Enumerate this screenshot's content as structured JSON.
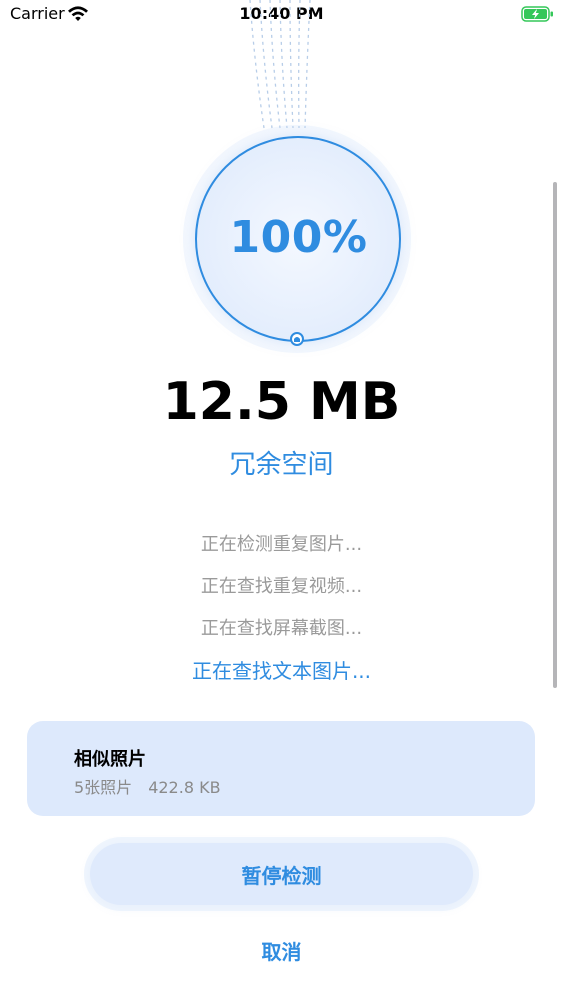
{
  "status_bar": {
    "carrier": "Carrier",
    "time": "10:40 PM"
  },
  "progress": {
    "percent_label": "100%",
    "value": 1.0,
    "color": "#2f8ce0"
  },
  "summary": {
    "size": "12.5 MB",
    "label": "冗余空间"
  },
  "scan_steps": [
    {
      "label": "正在检测重复图片...",
      "active": false
    },
    {
      "label": "正在查找重复视频...",
      "active": false
    },
    {
      "label": "正在查找屏幕截图...",
      "active": false
    },
    {
      "label": "正在查找文本图片...",
      "active": true
    }
  ],
  "result_card": {
    "title": "相似照片",
    "count": "5张照片",
    "size": "422.8 KB"
  },
  "actions": {
    "pause_label": "暂停检测",
    "cancel_label": "取消"
  },
  "colors": {
    "accent": "#2f8ce0",
    "card_bg": "#dde9fc",
    "muted_text": "#9a9a9a",
    "battery": "#34c759"
  }
}
